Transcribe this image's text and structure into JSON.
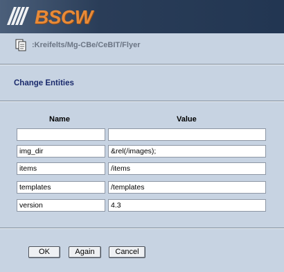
{
  "app": {
    "logo_text": "BSCW"
  },
  "breadcrumb": {
    "path": ":Kreifelts/Mg-CBe/CeBIT/Flyer"
  },
  "page": {
    "title": "Change Entities"
  },
  "table": {
    "headers": {
      "name": "Name",
      "value": "Value"
    },
    "rows": [
      {
        "name": "",
        "value": ""
      },
      {
        "name": "img_dir",
        "value": "&rel(/images);"
      },
      {
        "name": "items",
        "value": "/items"
      },
      {
        "name": "templates",
        "value": "/templates"
      },
      {
        "name": "version",
        "value": "4.3"
      }
    ]
  },
  "buttons": {
    "ok": "OK",
    "again": "Again",
    "cancel": "Cancel"
  },
  "colors": {
    "header_bg": "#223652",
    "logo": "#e98a37",
    "title": "#1a2a6c",
    "page_bg": "#c7d3e2"
  }
}
